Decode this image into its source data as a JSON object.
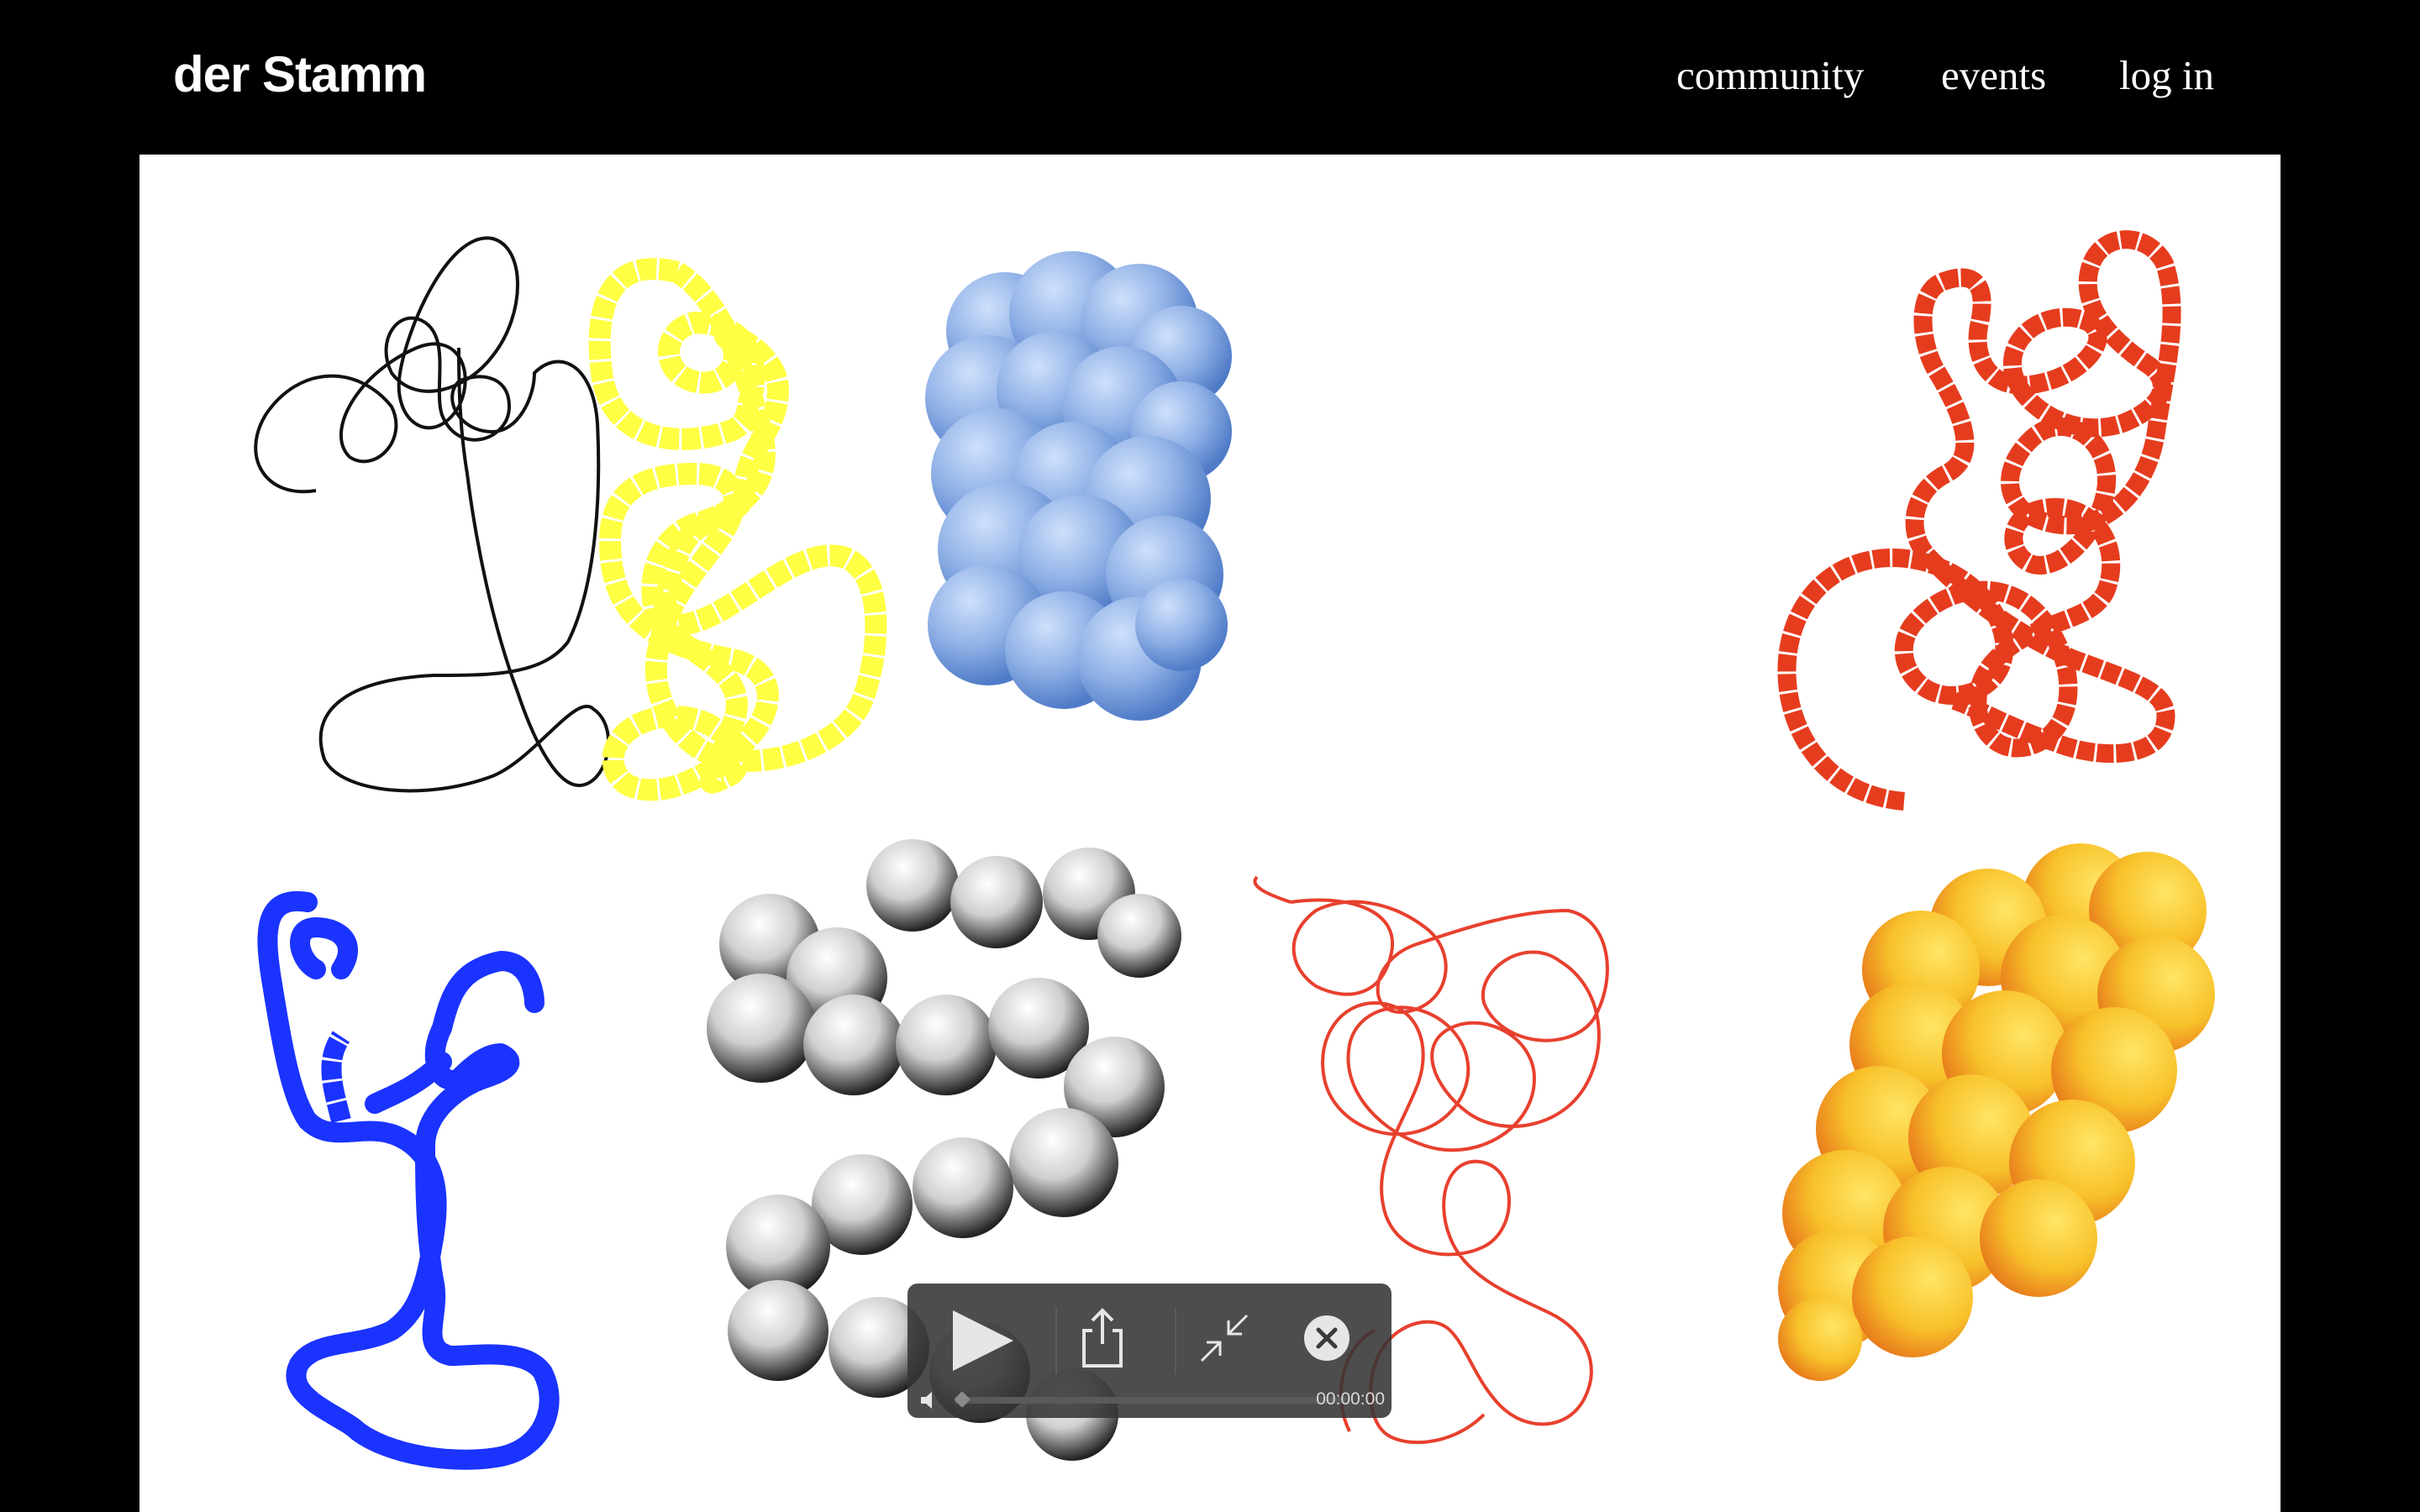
{
  "header": {
    "brand": "der Stamm",
    "nav": {
      "community": "community",
      "events": "events",
      "login": "log in"
    }
  },
  "gallery": {
    "items": [
      {
        "style": "thin-line",
        "color": "#111111"
      },
      {
        "style": "dashed-thick-line",
        "color": "#ffff44"
      },
      {
        "style": "3d-tube",
        "color": "#6f97d8"
      },
      {
        "style": "dashed-thick-line",
        "color": "#e63c1e"
      },
      {
        "style": "dashed-thick-line",
        "color": "#1a33ff"
      },
      {
        "style": "3d-tube",
        "color": "#1a1a1a"
      },
      {
        "style": "thin-line",
        "color": "#e8402e"
      },
      {
        "style": "3d-tube",
        "color": "#f2a41c"
      }
    ]
  },
  "video_controls": {
    "time": "00:00:00",
    "progress": 0,
    "icons": [
      "play-icon",
      "share-icon",
      "exit-fullscreen-icon",
      "close-icon",
      "volume-icon"
    ]
  }
}
